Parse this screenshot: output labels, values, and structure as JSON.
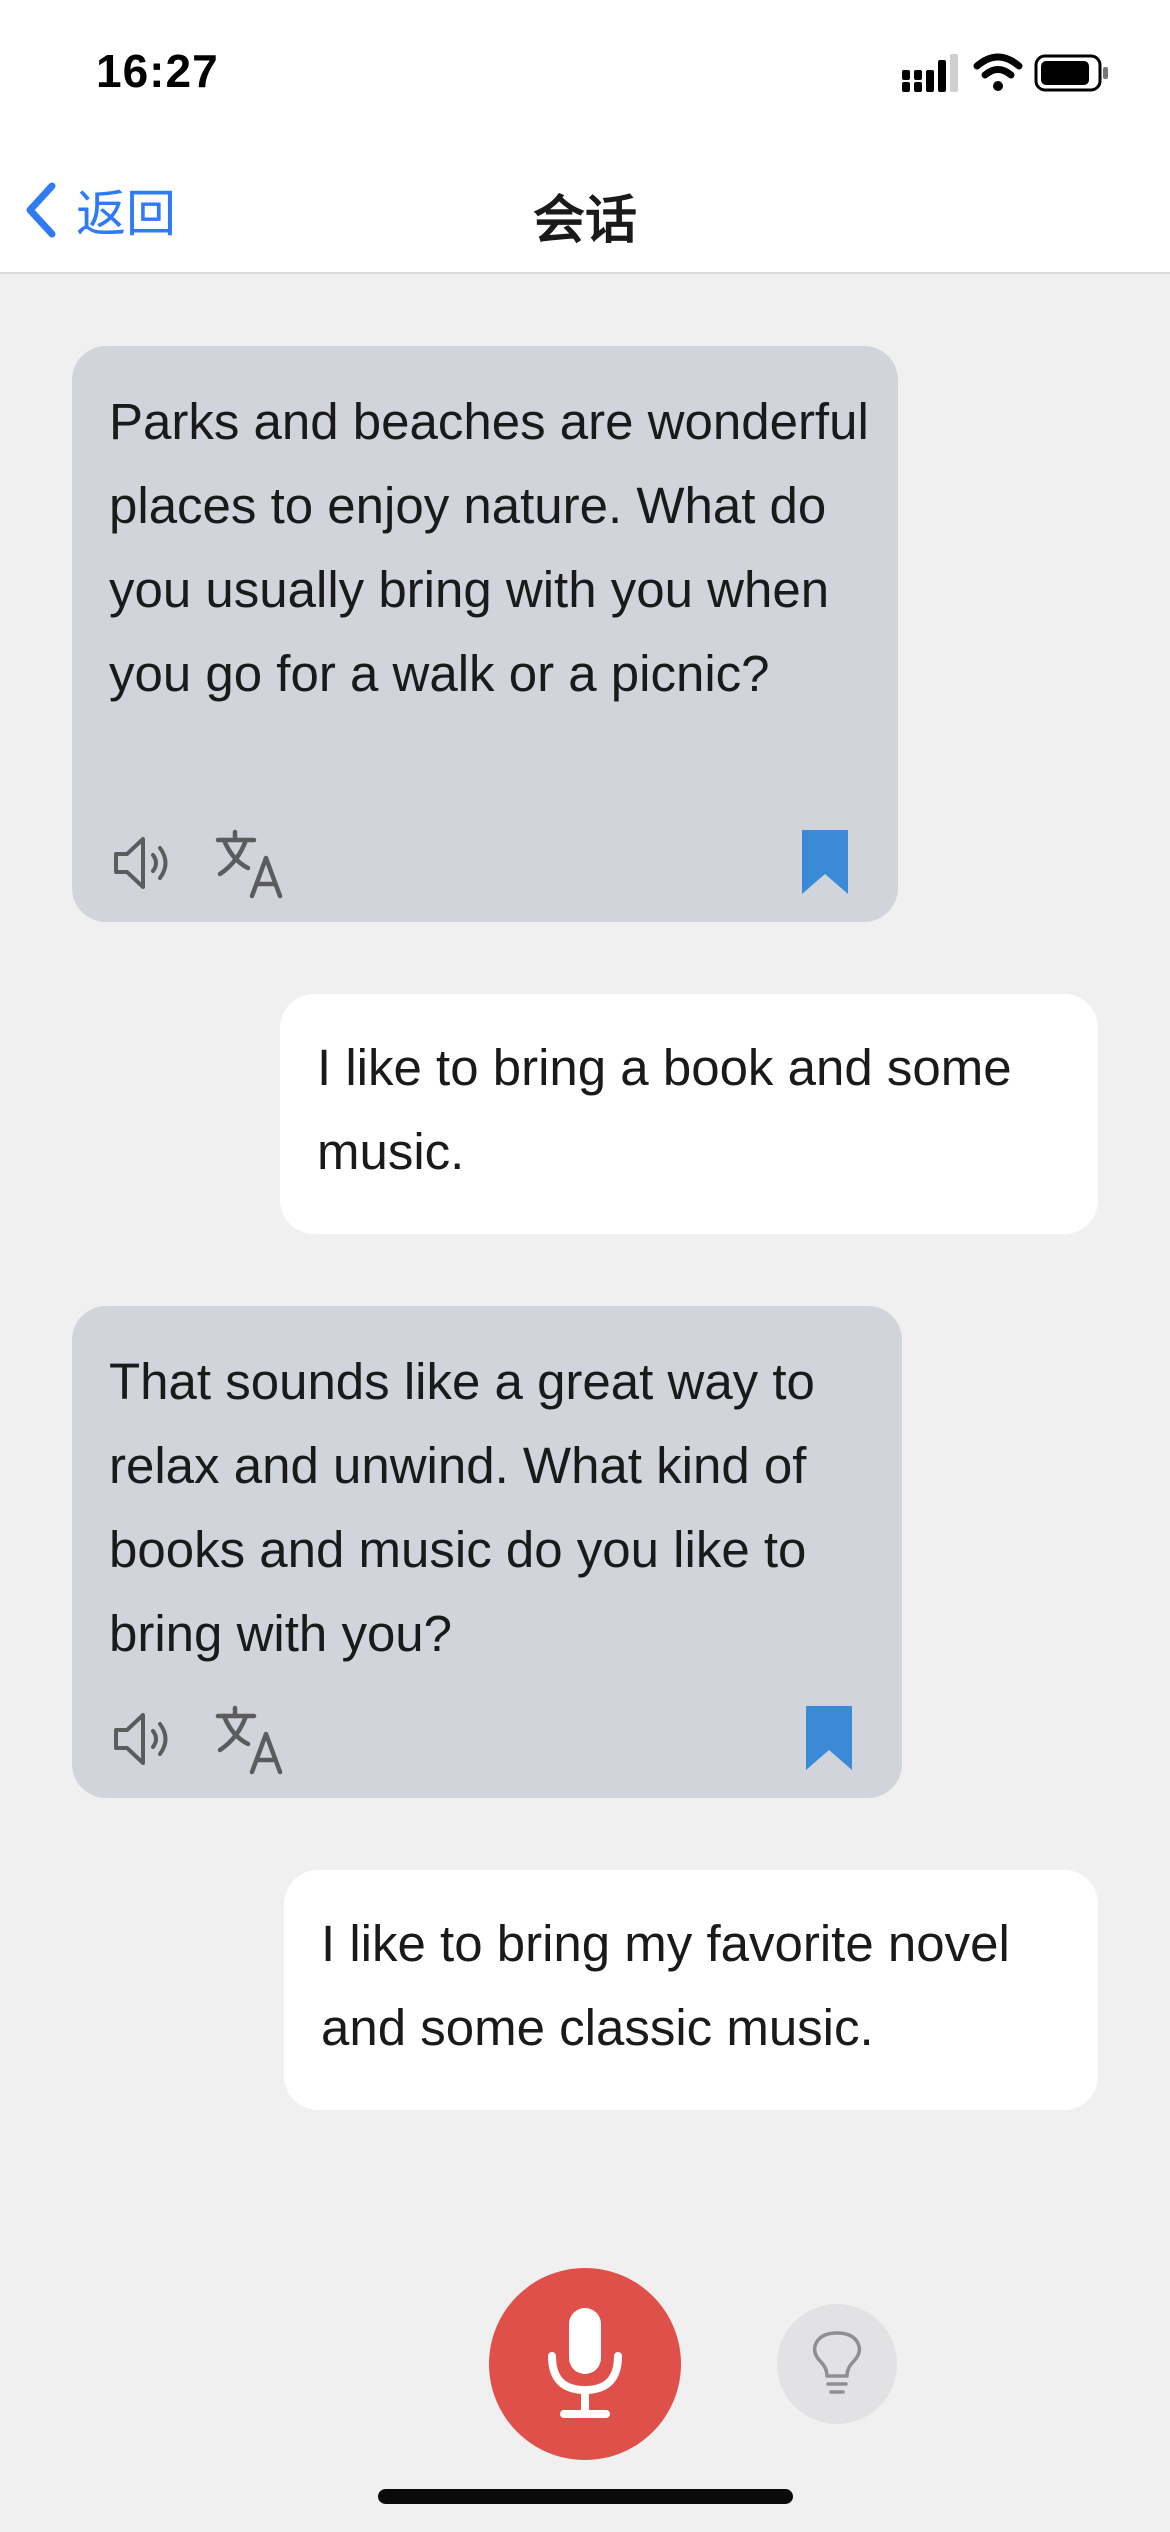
{
  "status_bar": {
    "time": "16:27",
    "icons": [
      "cellular-signal-icon",
      "wifi-icon",
      "battery-icon"
    ]
  },
  "nav": {
    "back_label": "返回",
    "title": "会话",
    "accent_color": "#2f7bf5"
  },
  "messages": [
    {
      "role": "ai",
      "text": "Parks and beaches are wonderful places to enjoy nature. What do you usually bring with you when you go for a walk or a picnic?",
      "actions": [
        "speaker-icon",
        "translate-icon",
        "bookmark-icon"
      ]
    },
    {
      "role": "user",
      "text": "I like to bring a book and some music."
    },
    {
      "role": "ai",
      "text": "That sounds like a great way to relax and unwind. What kind of books and music do you like to bring with you?",
      "actions": [
        "speaker-icon",
        "translate-icon",
        "bookmark-icon"
      ]
    },
    {
      "role": "user",
      "text": "I like to bring my favorite novel and some classic music."
    }
  ],
  "controls": {
    "mic_icon": "microphone-icon",
    "hint_icon": "lightbulb-icon",
    "mic_color": "#e0504a"
  },
  "colors": {
    "background": "#f0f0f0",
    "ai_bubble": "#d2d4dc",
    "user_bubble": "#ffffff",
    "bookmark": "#3a8ad8"
  }
}
